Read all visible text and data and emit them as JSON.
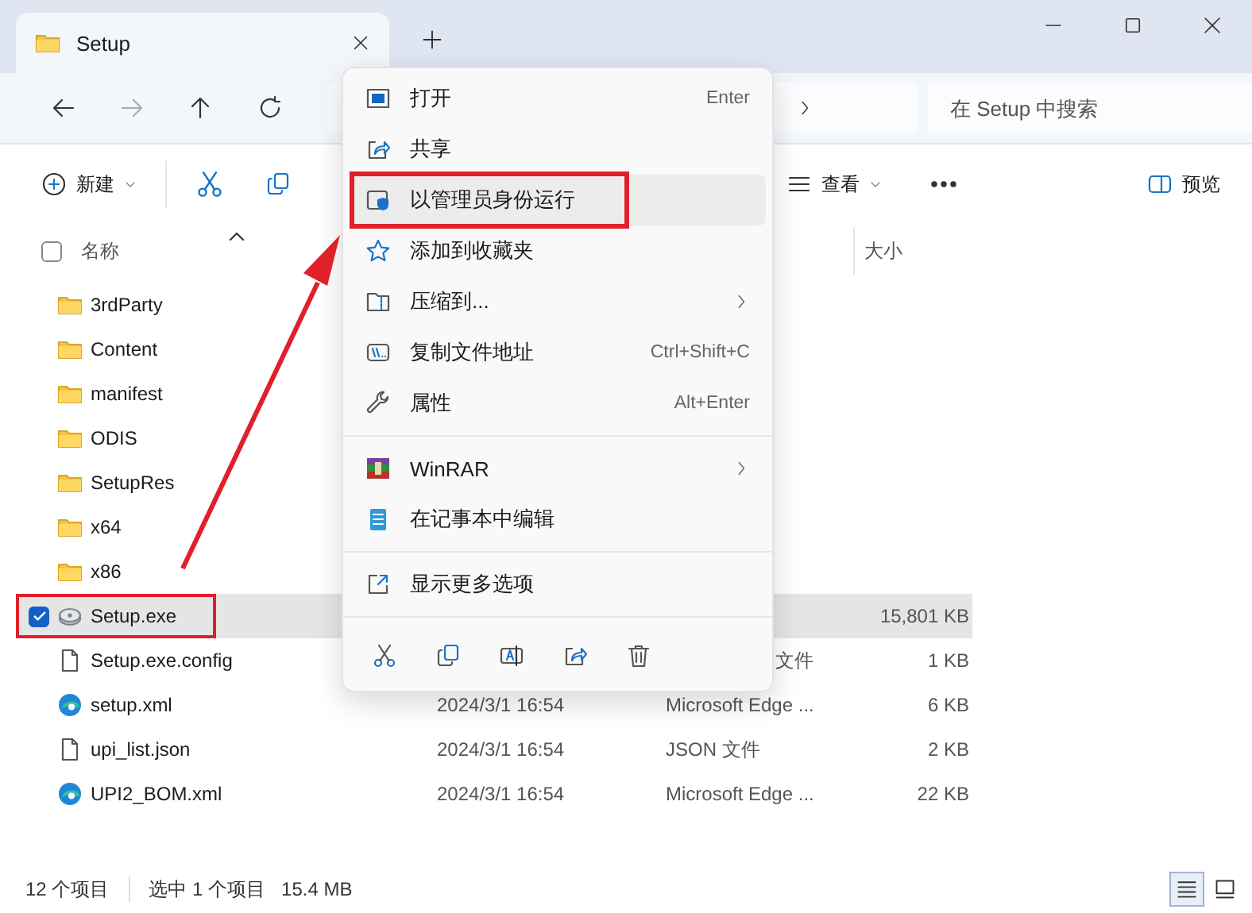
{
  "window": {
    "tab_title": "Setup"
  },
  "search": {
    "placeholder": "在 Setup 中搜索"
  },
  "toolbar": {
    "new_label": "新建",
    "view_label": "查看",
    "preview_label": "预览"
  },
  "select_all": {
    "checked": false
  },
  "columns": [
    {
      "label": "名称"
    },
    {
      "label": "大小"
    }
  ],
  "rows": [
    {
      "name": "3rdParty",
      "kind": "folder",
      "selected": false,
      "highlighted": false
    },
    {
      "name": "Content",
      "kind": "folder",
      "selected": false,
      "highlighted": false
    },
    {
      "name": "manifest",
      "kind": "folder",
      "selected": false,
      "highlighted": false
    },
    {
      "name": "ODIS",
      "kind": "folder",
      "selected": false,
      "highlighted": false
    },
    {
      "name": "SetupRes",
      "kind": "folder",
      "selected": false,
      "highlighted": false
    },
    {
      "name": "x64",
      "kind": "folder",
      "selected": false,
      "highlighted": false
    },
    {
      "name": "x86",
      "kind": "folder",
      "selected": false,
      "highlighted": false
    },
    {
      "name": "Setup.exe",
      "kind": "exe",
      "selected": true,
      "highlighted": true,
      "size": "15,801 KB"
    },
    {
      "name": "Setup.exe.config",
      "kind": "file",
      "selected": false,
      "highlighted": false,
      "type": "文件",
      "type_partial": true,
      "size": "1 KB"
    },
    {
      "name": "setup.xml",
      "kind": "edge",
      "selected": false,
      "highlighted": false,
      "date": "2024/3/1 16:54",
      "type": "Microsoft Edge ...",
      "size": "6 KB"
    },
    {
      "name": "upi_list.json",
      "kind": "file",
      "selected": false,
      "highlighted": false,
      "date": "2024/3/1 16:54",
      "type": "JSON 文件",
      "size": "2 KB"
    },
    {
      "name": "UPI2_BOM.xml",
      "kind": "edge",
      "selected": false,
      "highlighted": false,
      "date": "2024/3/1 16:54",
      "type": "Microsoft Edge ...",
      "size": "22 KB"
    }
  ],
  "context_menu": {
    "groups": [
      [
        {
          "label": "打开",
          "shortcut": "Enter",
          "selected": false,
          "highlighted": false,
          "submenu": false
        },
        {
          "label": "共享",
          "selected": false,
          "highlighted": false,
          "submenu": false
        },
        {
          "label": "以管理员身份运行",
          "selected": true,
          "highlighted": true,
          "submenu": false
        },
        {
          "label": "添加到收藏夹",
          "selected": false,
          "highlighted": false,
          "submenu": false
        },
        {
          "label": "压缩到...",
          "selected": false,
          "highlighted": false,
          "submenu": true
        },
        {
          "label": "复制文件地址",
          "shortcut": "Ctrl+Shift+C",
          "selected": false,
          "highlighted": false,
          "submenu": false
        },
        {
          "label": "属性",
          "shortcut": "Alt+Enter",
          "selected": false,
          "highlighted": false,
          "submenu": false
        }
      ],
      [
        {
          "label": "WinRAR",
          "selected": false,
          "highlighted": false,
          "submenu": true
        },
        {
          "label": "在记事本中编辑",
          "selected": false,
          "highlighted": false,
          "submenu": false
        }
      ],
      [
        {
          "label": "显示更多选项",
          "selected": false,
          "highlighted": false,
          "submenu": false
        }
      ]
    ]
  },
  "annotation": {
    "arrow": true
  },
  "status_bar": {
    "count": "12 个项目",
    "selection": "选中 1 个项目",
    "selection_size": "15.4 MB",
    "views": [
      {
        "kind": "details",
        "selected": true
      },
      {
        "kind": "tiles",
        "selected": false
      }
    ]
  }
}
